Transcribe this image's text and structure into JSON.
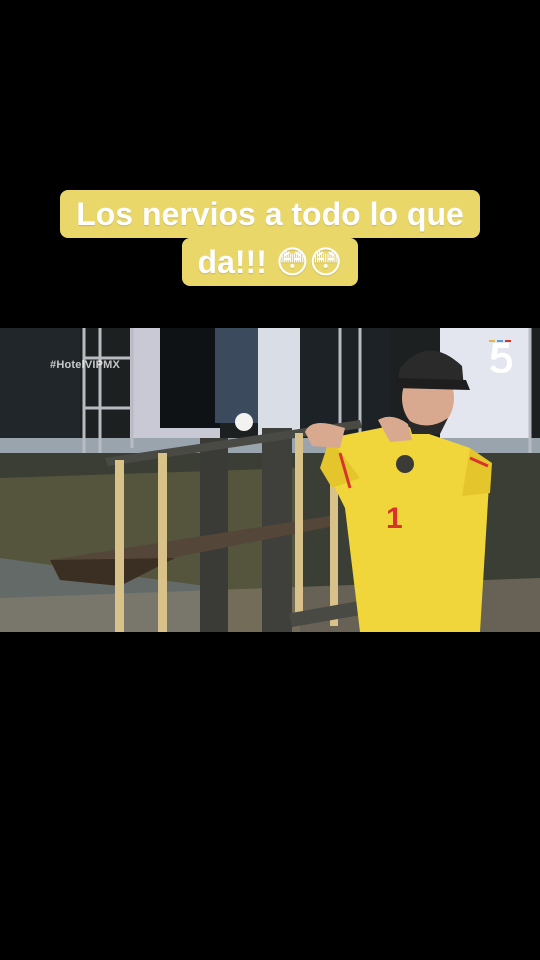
{
  "caption": {
    "line1": "Los nervios a todo lo que",
    "line2": "da!!! 😳😳"
  },
  "video": {
    "hashtag": "#HotelVIPMX",
    "channel_logo_icon": "channel-5-logo",
    "jersey_number": "1"
  },
  "colors": {
    "caption_bg": "#ead76a",
    "jersey": "#f0d63a",
    "jersey_accent": "#d9342b"
  }
}
